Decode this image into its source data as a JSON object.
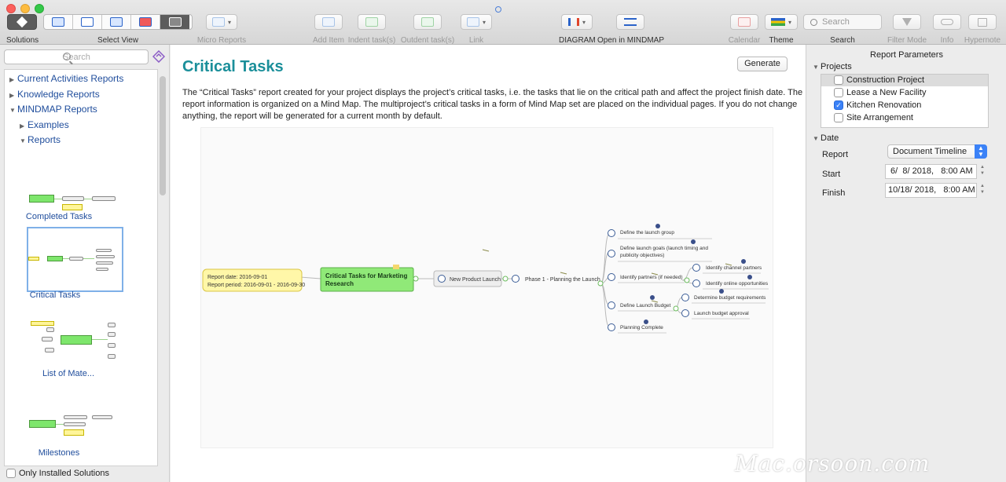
{
  "toolbar": {
    "solutions": "Solutions",
    "select_view": "Select View",
    "micro_reports": "Micro Reports",
    "add_item": "Add Item",
    "indent": "Indent task(s)",
    "outdent": "Outdent task(s)",
    "link": "Link",
    "diagram": "DIAGRAM",
    "open_mindmap": "Open in MINDMAP",
    "calendar": "Calendar",
    "theme": "Theme",
    "search_placeholder": "Search",
    "search_label": "Search",
    "filter_mode": "Filter Mode",
    "info": "Info",
    "hypernote": "Hypernote"
  },
  "sidebar": {
    "search_placeholder": "Search",
    "tree": [
      {
        "label": "Current Activities Reports",
        "expanded": false
      },
      {
        "label": "Knowledge Reports",
        "expanded": false
      },
      {
        "label": "MINDMAP Reports",
        "expanded": true
      },
      {
        "label": "Examples",
        "expanded": false
      },
      {
        "label": "Reports",
        "expanded": true
      }
    ],
    "thumbnails": [
      {
        "caption": "Completed Tasks",
        "selected": false
      },
      {
        "caption": "Critical Tasks",
        "selected": true
      },
      {
        "caption": "List of Mate...",
        "selected": false
      },
      {
        "caption": "Milestones",
        "selected": false
      }
    ],
    "only_installed": "Only Installed Solutions"
  },
  "main": {
    "title": "Critical Tasks",
    "generate": "Generate",
    "description": "The “Critical Tasks” report created for your project displays the project’s critical tasks, i.e. the tasks that lie on the critical path and affect the project finish date. The report information is organized on a Mind Map. The multiproject’s critical tasks in a form of Mind Map set are placed on the individual pages. If you do not change anything, the report will be generated for a current month by default.",
    "mindmap": {
      "report_date": "Report date: 2016-09-01",
      "report_period": "Report period: 2016-09-01 - 2016-09-30",
      "root_line1": "Critical Tasks for Marketing",
      "root_line2": "Research",
      "product": "New Product Launch",
      "phase": "Phase 1 - Planning the Launch",
      "tasks": {
        "t1": "Define the launch group",
        "t2a": "Define launch goals (launch timing and",
        "t2b": "publicity objectives)",
        "t3": "Identify partners (if needed)",
        "t3a": "Identify channel partners",
        "t3b": "Identify online opportunities",
        "t4": "Define Launch Budget",
        "t4a": "Determine budget requirements",
        "t4b": "Launch budget approval",
        "t5": "Planning Complete"
      }
    }
  },
  "params": {
    "title": "Report Parameters",
    "projects_label": "Projects",
    "projects": [
      {
        "name": "Construction Project",
        "checked": false
      },
      {
        "name": "Lease a New Facility",
        "checked": false
      },
      {
        "name": "Kitchen Renovation",
        "checked": true
      },
      {
        "name": "Site Arrangement",
        "checked": false
      }
    ],
    "date_label": "Date",
    "report_label": "Report",
    "report_value": "Document Timeline",
    "start_label": "Start",
    "start_value": " 6/  8/ 2018,   8:00 AM",
    "finish_label": "Finish",
    "finish_value": "10/18/ 2018,   8:00 AM"
  },
  "watermark": "Mac.orsoon.com",
  "colors": {
    "accent": "#1b8f9a",
    "link": "#1f4d9c",
    "root_node": "#90e978",
    "date_note": "#fff7a8",
    "check": "#3b82f7"
  }
}
